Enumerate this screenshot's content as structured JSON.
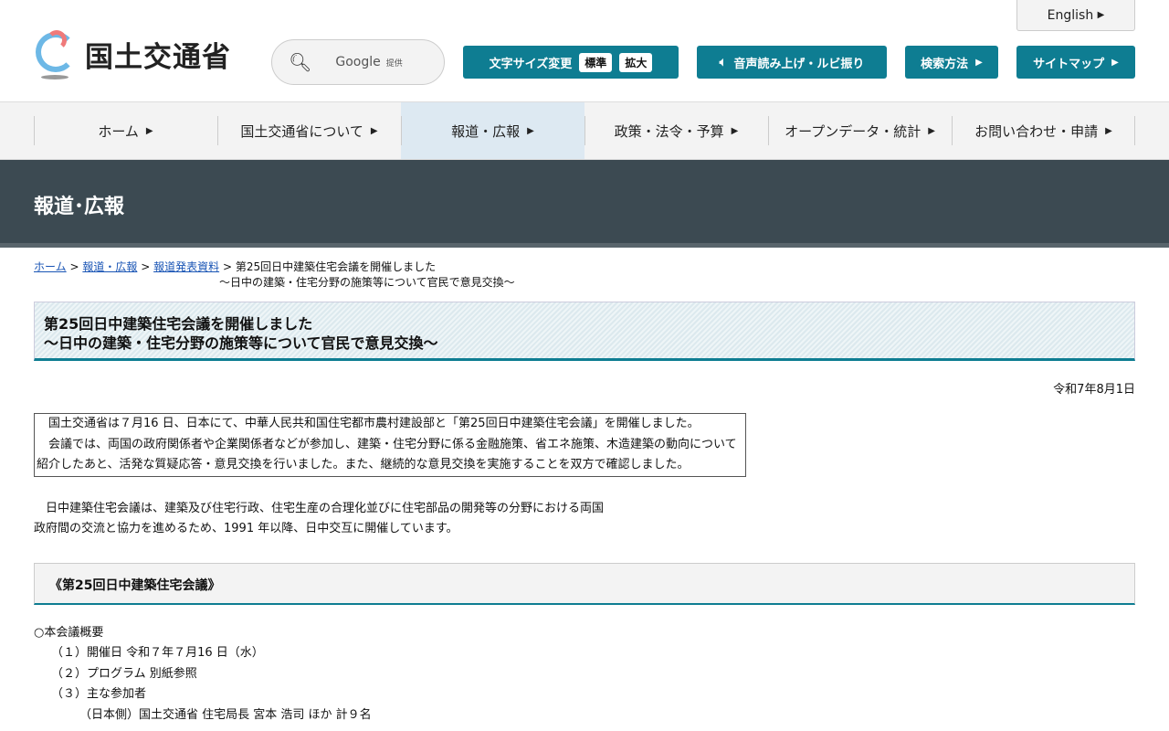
{
  "header": {
    "logo_text": "国土交通省",
    "search_brand": "Google",
    "search_provided": "提供",
    "english": "English",
    "font_size_label": "文字サイズ変更",
    "font_standard": "標準",
    "font_large": "拡大",
    "read_aloud": "音声読み上げ・ルビ振り",
    "search_method": "検索方法",
    "sitemap": "サイトマップ"
  },
  "nav": [
    "ホーム",
    "国土交通省について",
    "報道・広報",
    "政策・法令・予算",
    "オープンデータ・統計",
    "お問い合わせ・申請"
  ],
  "band_title": "報道･広報",
  "breadcrumb": {
    "home": "ホーム",
    "press": "報道・広報",
    "releases": "報道発表資料",
    "current1": "第25回日中建築住宅会議を開催しました",
    "current2": "～日中の建築・住宅分野の施策等について官民で意見交換～",
    "sep": ">"
  },
  "title": {
    "line1": "第25回日中建築住宅会議を開催しました",
    "line2": "～日中の建築・住宅分野の施策等について官民で意見交換～"
  },
  "date": "令和7年8月1日",
  "lead": {
    "p1": "　国土交通省は７月16 日、日本にて、中華人民共和国住宅都市農村建設部と「第25回日中建築住宅会議」を開催しました。",
    "p2": "　会議では、両国の政府関係者や企業関係者などが参加し、建築・住宅分野に係る金融施策、省エネ施策、木造建築の動向について紹介したあと、活発な質疑応答・意見交換を行いました。また、継続的な意見交換を実施することを双方で確認しました。"
  },
  "para": {
    "l1": "　日中建築住宅会議は、建築及び住宅行政、住宅生産の合理化並びに住宅部品の開発等の分野における両国",
    "l2": "政府間の交流と協力を進めるため、1991 年以降、日中交互に開催しています。"
  },
  "section_title": "《第25回日中建築住宅会議》",
  "list": {
    "head": "○本会議概要",
    "items": [
      "（１）開催日 令和７年７月16 日（水）",
      "（２）プログラム 別紙参照",
      "（３）主な参加者"
    ],
    "sub": "（日本側）国土交通省 住宅局長 宮本 浩司 ほか 計９名"
  }
}
